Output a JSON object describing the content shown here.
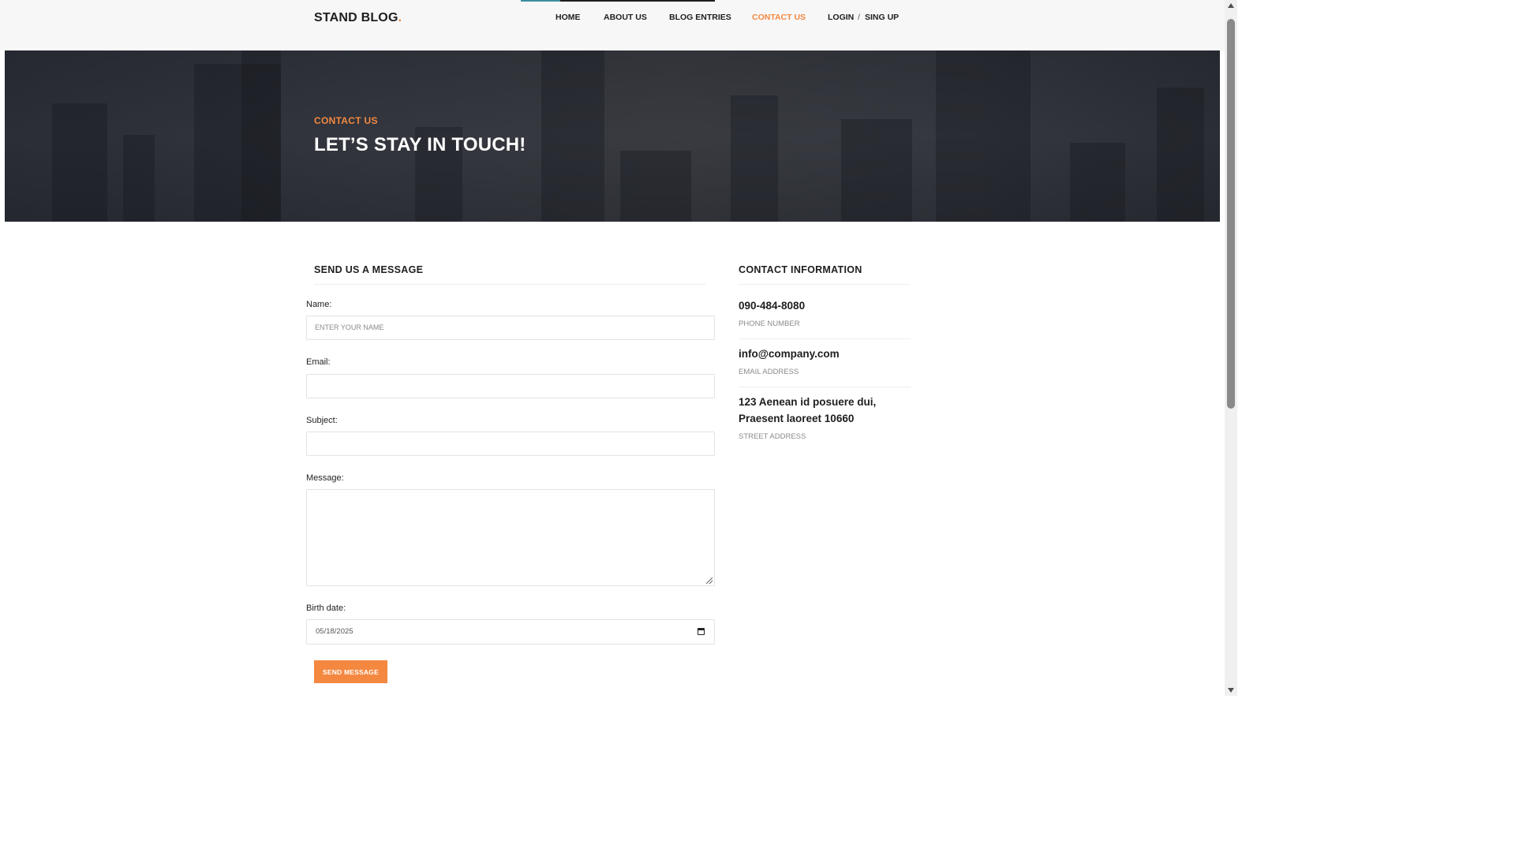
{
  "header": {
    "logo_text": "STAND BLOG",
    "logo_dot": ".",
    "nav": [
      {
        "label": "HOME"
      },
      {
        "label": "ABOUT US"
      },
      {
        "label": "BLOG ENTRIES"
      },
      {
        "label": "CONTACT US"
      },
      {
        "label": "LOGIN"
      },
      {
        "label": "SING UP"
      }
    ],
    "nav_separator": "/"
  },
  "hero": {
    "subtitle": "CONTACT US",
    "title": "LET’S STAY IN TOUCH!"
  },
  "form": {
    "title": "SEND US A MESSAGE",
    "name_label": "Name:",
    "name_placeholder": "ENTER YOUR NAME",
    "email_label": "Email:",
    "subject_label": "Subject:",
    "message_label": "Message:",
    "birth_label": "Birth date:",
    "birth_value": "05/18/2025",
    "submit_label": "SEND MESSAGE"
  },
  "contact_info": {
    "title": "CONTACT INFORMATION",
    "phone": "090-484-8080",
    "phone_caption": "PHONE NUMBER",
    "email": "info@company.com",
    "email_caption": "EMAIL ADDRESS",
    "address_line1": "123 Aenean id posuere dui,",
    "address_line2": "Praesent laoreet 10660",
    "address_caption": "STREET ADDRESS"
  },
  "colors": {
    "accent": "#f48840",
    "dark": "#1e1e1e",
    "muted": "#8a8a8a"
  }
}
